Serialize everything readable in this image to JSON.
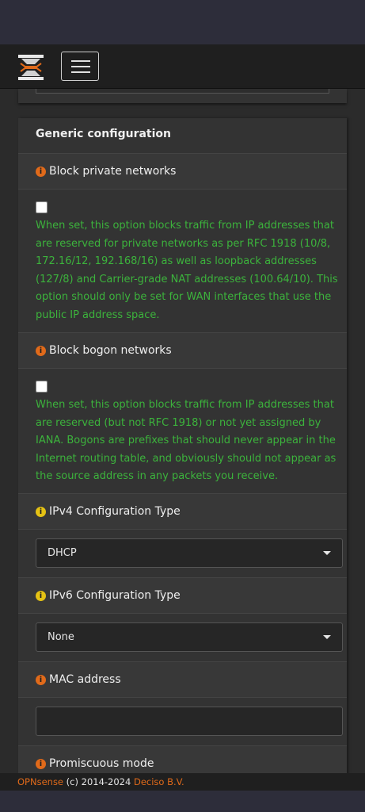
{
  "colors": {
    "accent": "#e06a1a",
    "help_text": "#3cb33c",
    "info_icon_orange": "#e06a1a",
    "info_icon_yellow": "#e5c214"
  },
  "header": {
    "logo_icon": "opnsense-logo-icon",
    "menu_icon": "hamburger-menu-icon"
  },
  "panel": {
    "title": "Generic configuration",
    "block_private": {
      "label": "Block private networks",
      "checked": false,
      "help": "When set, this option blocks traffic from IP addresses that are reserved for private networks as per RFC 1918 (10/8, 172.16/12, 192.168/16) as well as loopback addresses (127/8) and Carrier-grade NAT addresses (100.64/10). This option should only be set for WAN interfaces that use the public IP address space."
    },
    "block_bogon": {
      "label": "Block bogon networks",
      "checked": false,
      "help": "When set, this option blocks traffic from IP addresses that are reserved (but not RFC 1918) or not yet assigned by IANA. Bogons are prefixes that should never appear in the Internet routing table, and obviously should not appear as the source address in any packets you receive."
    },
    "ipv4_type": {
      "label": "IPv4 Configuration Type",
      "value": "DHCP"
    },
    "ipv6_type": {
      "label": "IPv6 Configuration Type",
      "value": "None"
    },
    "mac_address": {
      "label": "MAC address",
      "value": ""
    },
    "promiscuous": {
      "label": "Promiscuous mode"
    }
  },
  "footer": {
    "brand": "OPNsense",
    "copyright": "(c) 2014-2024",
    "company": "Deciso B.V."
  }
}
